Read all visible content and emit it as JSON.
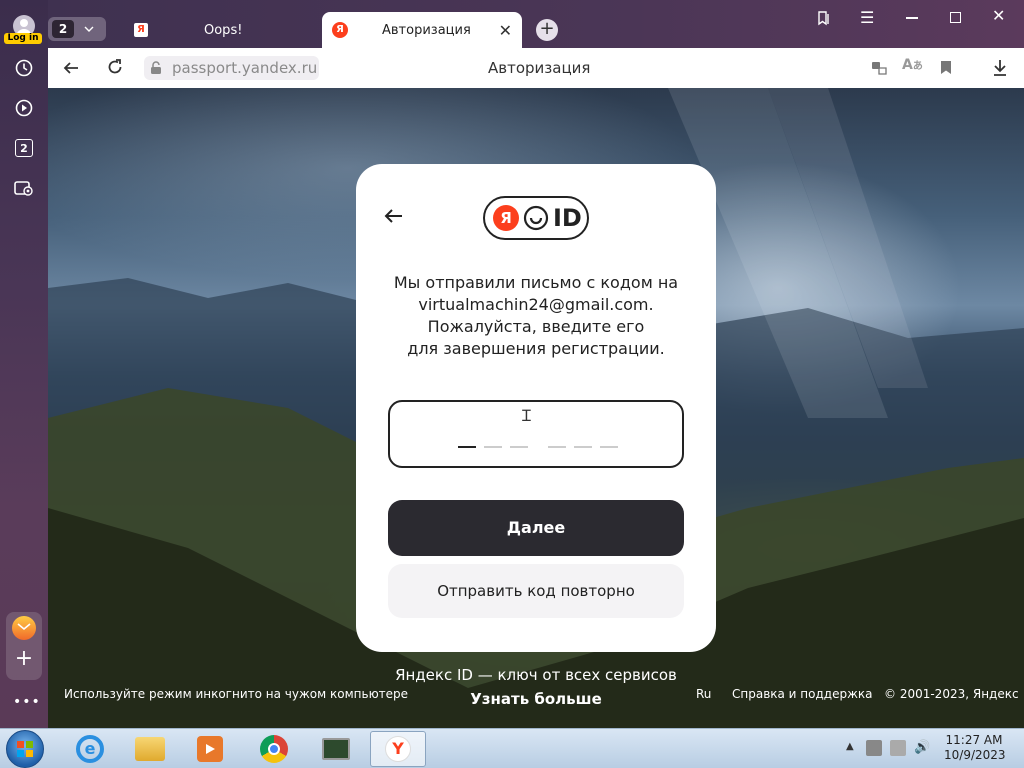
{
  "browser": {
    "login_label": "Log in",
    "tab_count": "2",
    "tabs": [
      {
        "title": "Oops!"
      },
      {
        "title": "Авторизация"
      }
    ],
    "address": "passport.yandex.ru",
    "page_title": "Авторизация",
    "sidebar_badge": "2"
  },
  "card": {
    "logo_letter": "Я",
    "logo_text": "ID",
    "message_lines": [
      "Мы отправили письмо с кодом на",
      "virtualmachin24@gmail.com.",
      "Пожалуйста, введите его",
      "для завершения регистрации."
    ],
    "next_button": "Далее",
    "resend_button": "Отправить код повторно"
  },
  "footer": {
    "tagline": "Яндекс ID — ключ от всех сервисов",
    "learn_more": "Узнать больше",
    "incognito_hint": "Используйте режим инкогнито на чужом компьютере",
    "lang": "Ru",
    "help": "Справка и поддержка",
    "copyright": "© 2001-2023, Яндекс"
  },
  "taskbar": {
    "time": "11:27 AM",
    "date": "10/9/2023"
  },
  "colors": {
    "dark_button": "#2b2a30",
    "yandex_red": "#fc3f1d"
  }
}
